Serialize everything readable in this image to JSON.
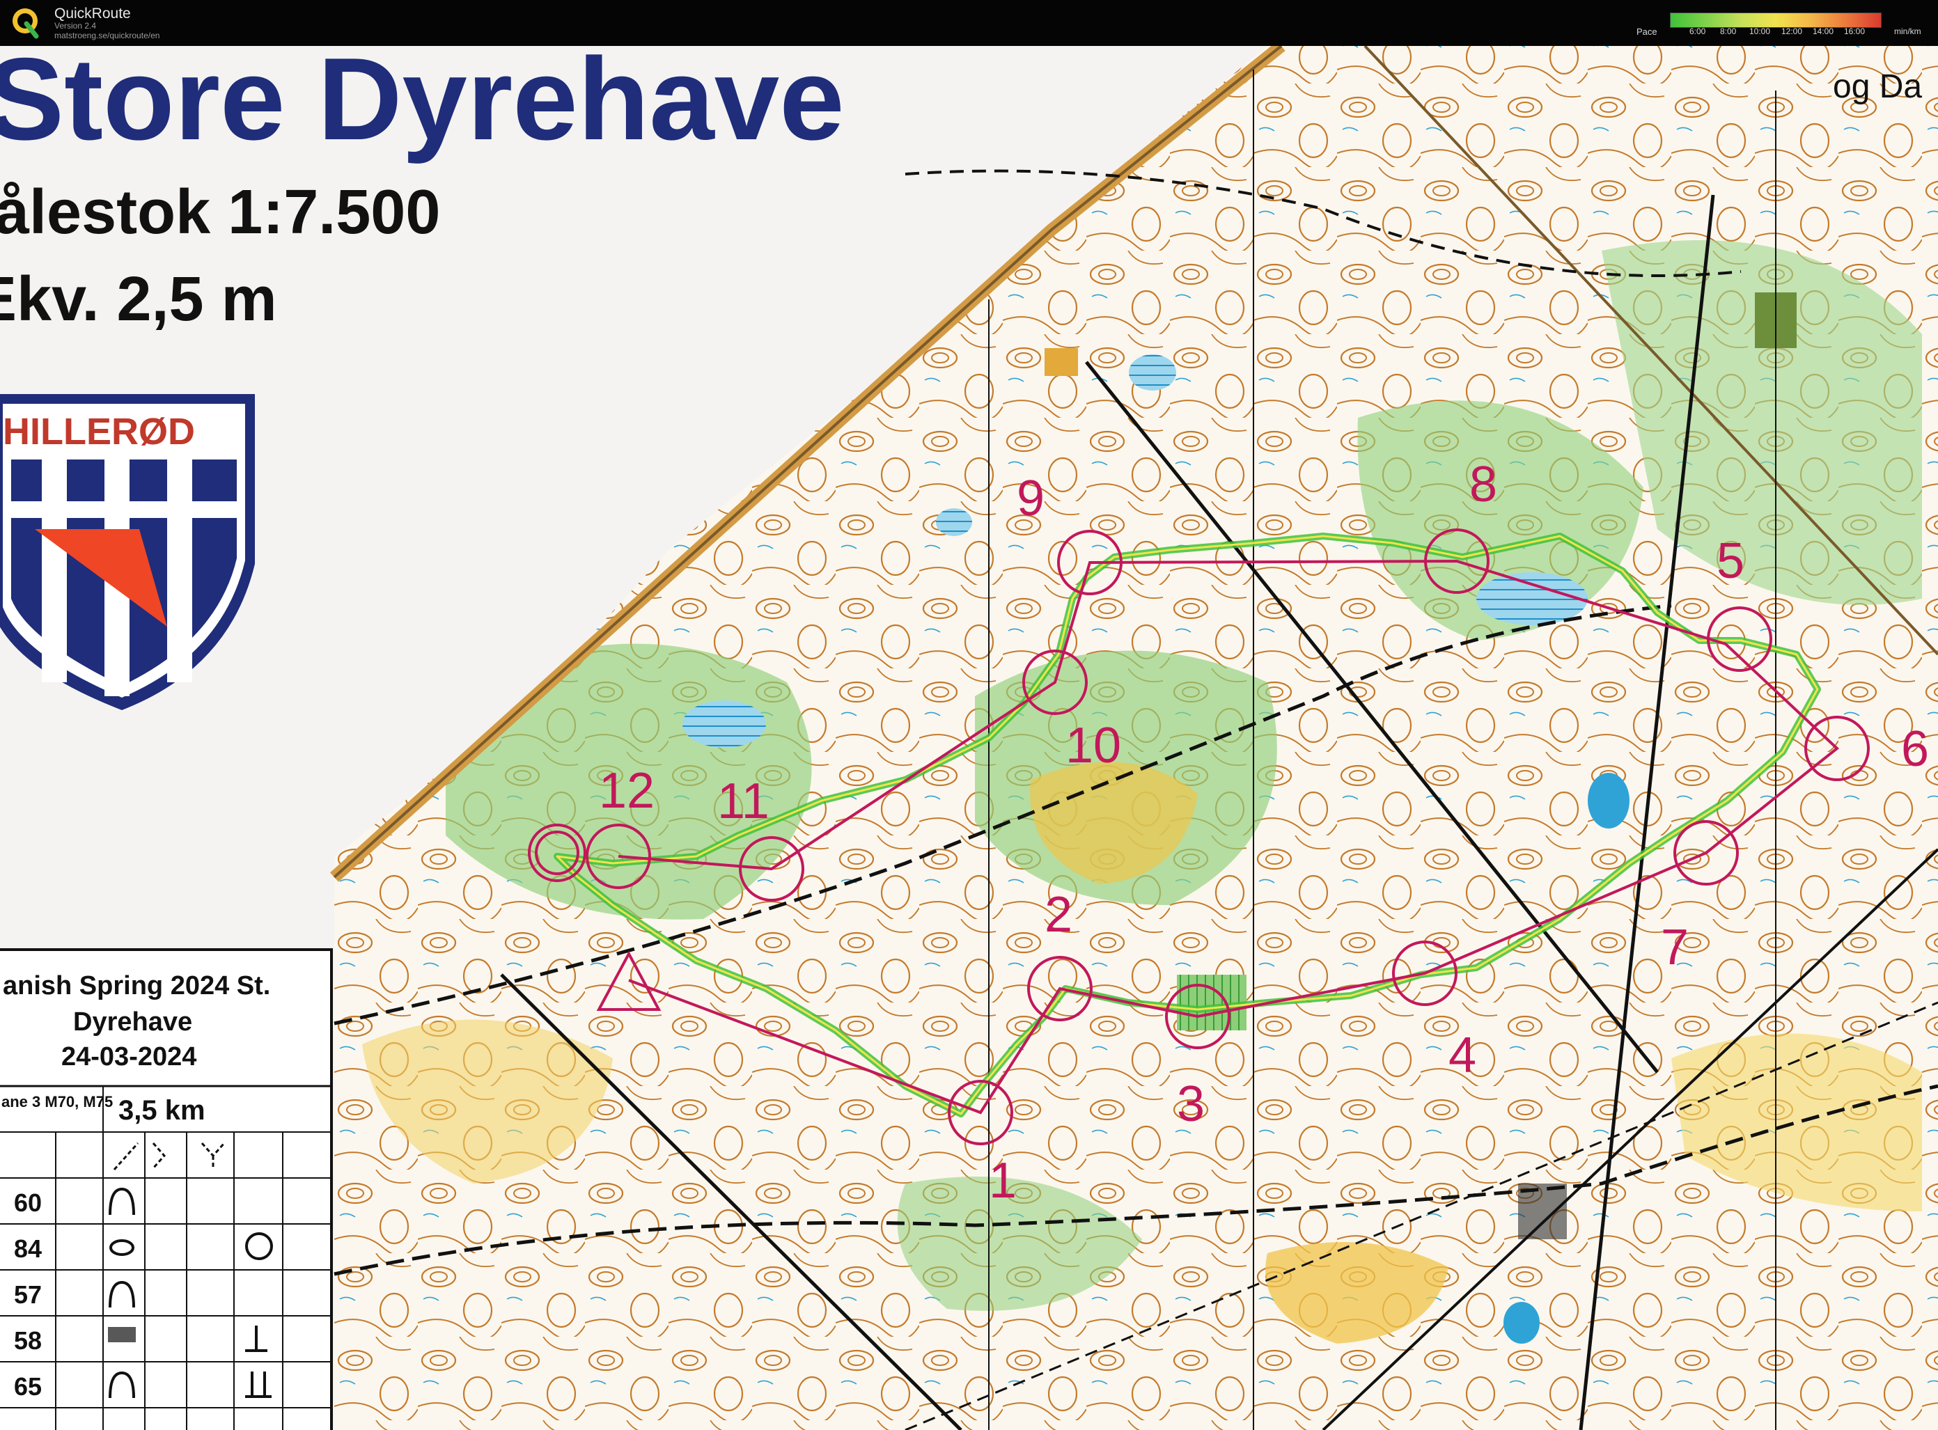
{
  "app": {
    "name": "QuickRoute",
    "version": "Version 2.4",
    "url": "matstroeng.se/quickroute/en"
  },
  "pace_legend": {
    "label": "Pace",
    "ticks": [
      "6:00",
      "8:00",
      "10:00",
      "12:00",
      "14:00",
      "16:00"
    ],
    "unit": "min/km",
    "colors": [
      "#3fc23a",
      "#7fd24a",
      "#c6e05a",
      "#f1e34f",
      "#f3b848",
      "#ec7a3d",
      "#d93b2f"
    ]
  },
  "map": {
    "title": "Store Dyrehave",
    "scale_text": "ålestok 1:7.500",
    "contour_text": "Ekv. 2,5 m",
    "corner_text": "og Da",
    "club_logo_text": "HILLERØD",
    "event_box": {
      "line1": "anish Spring 2024 St.",
      "line2": "Dyrehave",
      "date": "24-03-2024",
      "class": "ane 3 M70, M75",
      "length": "3,5 km",
      "codes": [
        "60",
        "84",
        "57",
        "58",
        "65"
      ]
    },
    "controls": [
      "1",
      "2",
      "3",
      "4",
      "5",
      "6",
      "7",
      "8",
      "9",
      "10",
      "11",
      "12"
    ],
    "colors": {
      "course": "#c2185b",
      "contour": "#c47a2c",
      "title_blue": "#1f2d7a",
      "forest_green": "#7fc76b",
      "open_yellow": "#f0c44a",
      "water_blue": "#2fa3d6"
    }
  }
}
